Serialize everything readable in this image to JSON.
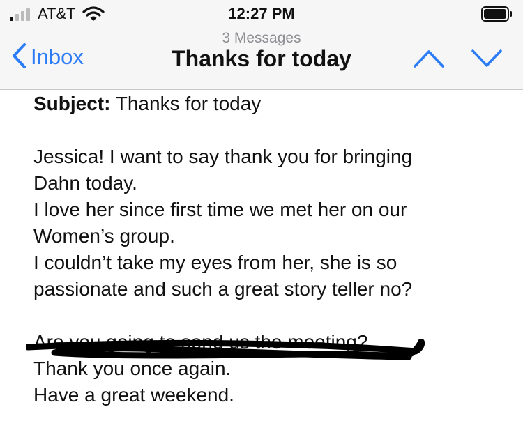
{
  "status_bar": {
    "carrier": "AT&T",
    "time": "12:27 PM",
    "icons": [
      "signal-icon",
      "wifi-icon",
      "battery-icon"
    ]
  },
  "nav": {
    "back_label": "Inbox",
    "message_count": "3 Messages",
    "title": "Thanks for today",
    "icons": [
      "chevron-left-icon",
      "chevron-up-icon",
      "chevron-down-icon"
    ],
    "accent_color": "#2b7cf6"
  },
  "email": {
    "subject_label": "Subject:",
    "subject": "Thanks for today",
    "lines": [
      "Jessica! I want to say thank you for bringing",
      "Dahn today.",
      "I love her since first time we met her on our",
      "Women’s group.",
      "I couldn’t take my eyes from her, she is so",
      "passionate and such a great story teller no?"
    ],
    "redacted_line": "Are you going to send us the meeting?",
    "closing_lines": [
      "Thank you once again.",
      "Have a great weekend."
    ]
  }
}
